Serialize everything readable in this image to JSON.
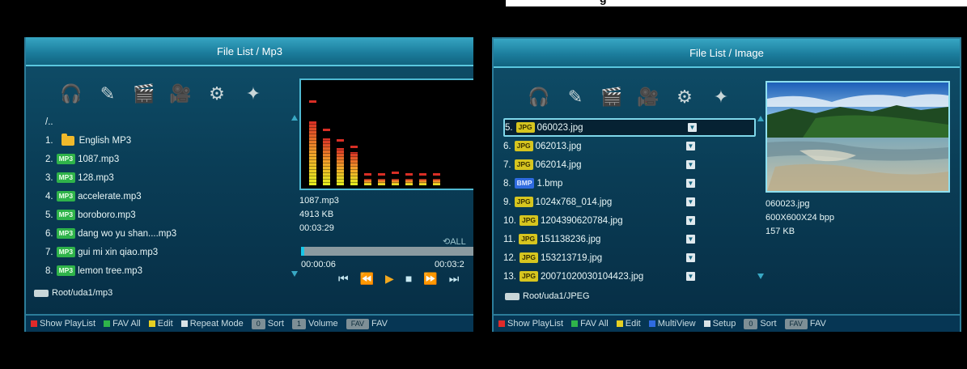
{
  "top_fragment": "g",
  "colors": {
    "red_key": "#e02a2a",
    "green_key": "#2fb34a",
    "yellow_key": "#e6cf22",
    "blue_key": "#2f6be0",
    "white_key": "#d8e2e6"
  },
  "icons": [
    "music-icon",
    "photo-icon",
    "clapper-icon",
    "camera-icon",
    "gears-icon",
    "tools-icon"
  ],
  "left": {
    "title": "File List / Mp3",
    "parent": "/..",
    "items": [
      {
        "num": "1.",
        "type": "folder",
        "name": "English MP3"
      },
      {
        "num": "2.",
        "type": "MP3",
        "name": "1087.mp3"
      },
      {
        "num": "3.",
        "type": "MP3",
        "name": "128.mp3"
      },
      {
        "num": "4.",
        "type": "MP3",
        "name": "accelerate.mp3"
      },
      {
        "num": "5.",
        "type": "MP3",
        "name": "boroboro.mp3"
      },
      {
        "num": "6.",
        "type": "MP3",
        "name": "dang wo yu shan....mp3"
      },
      {
        "num": "7.",
        "type": "MP3",
        "name": "gui mi xin qiao.mp3"
      },
      {
        "num": "8.",
        "type": "MP3",
        "name": "lemon tree.mp3"
      }
    ],
    "spectrum_levels": [
      0.62,
      0.45,
      0.36,
      0.32,
      0.06,
      0.06,
      0.06,
      0.06,
      0.06,
      0.06
    ],
    "spectrum_peaks": [
      0.8,
      0.52,
      0.42,
      0.36,
      0.09,
      0.09,
      0.11,
      0.09,
      0.09,
      0.09
    ],
    "file_name": "1087.mp3",
    "file_size": "4913 KB",
    "duration": "00:03:29",
    "repeat": "ALL",
    "progress": 0.01,
    "elapsed": "00:00:06",
    "total": "00:03:2",
    "path": "Root/uda1/mp3",
    "footer": [
      {
        "color": "#e02a2a",
        "label": "Show PlayList"
      },
      {
        "color": "#2fb34a",
        "label": "FAV All"
      },
      {
        "color": "#e6cf22",
        "label": "Edit"
      },
      {
        "color": "#d8e2e6",
        "label": "Repeat Mode"
      }
    ],
    "footer_keys": [
      {
        "key": "0",
        "label": "Sort"
      },
      {
        "key": "1",
        "label": "Volume"
      },
      {
        "key": "FAV",
        "label": "FAV"
      }
    ]
  },
  "right": {
    "title": "File List / Image",
    "items": [
      {
        "num": "5.",
        "type": "JPG",
        "name": "060023.jpg",
        "selected": true
      },
      {
        "num": "6.",
        "type": "JPG",
        "name": "062013.jpg"
      },
      {
        "num": "7.",
        "type": "JPG",
        "name": "062014.jpg"
      },
      {
        "num": "8.",
        "type": "BMP",
        "name": "1.bmp"
      },
      {
        "num": "9.",
        "type": "JPG",
        "name": "1024x768_014.jpg"
      },
      {
        "num": "10.",
        "type": "JPG",
        "name": "1204390620784.jpg"
      },
      {
        "num": "11.",
        "type": "JPG",
        "name": "151138236.jpg"
      },
      {
        "num": "12.",
        "type": "JPG",
        "name": "153213719.jpg"
      },
      {
        "num": "13.",
        "type": "JPG",
        "name": "20071020030104423.jpg"
      }
    ],
    "info_name": "060023.jpg",
    "info_res": "600X600X24 bpp",
    "info_size": "157 KB",
    "path": "Root/uda1/JPEG",
    "footer": [
      {
        "color": "#e02a2a",
        "label": "Show PlayList"
      },
      {
        "color": "#2fb34a",
        "label": "FAV All"
      },
      {
        "color": "#e6cf22",
        "label": "Edit"
      },
      {
        "color": "#2f6be0",
        "label": "MultiView"
      },
      {
        "color": "#d8e2e6",
        "label": "Setup"
      }
    ],
    "footer_keys": [
      {
        "key": "0",
        "label": "Sort"
      },
      {
        "key": "FAV",
        "label": "FAV"
      }
    ]
  }
}
